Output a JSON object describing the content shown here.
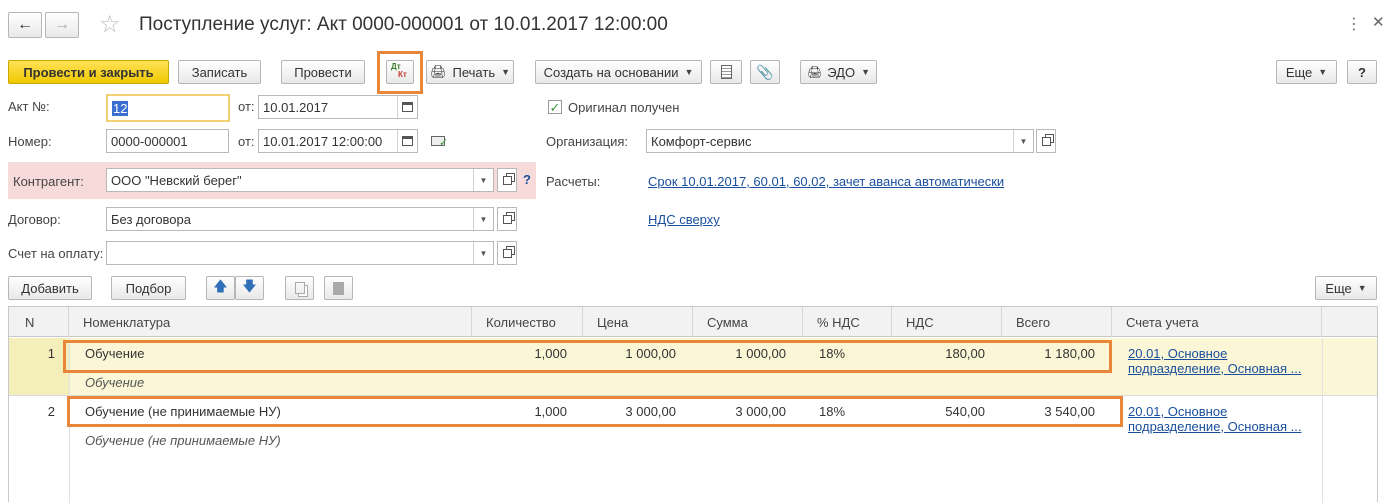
{
  "window": {
    "title": "Поступление услуг: Акт 0000-000001 от 10.01.2017 12:00:00"
  },
  "toolbar": {
    "post_close": "Провести и закрыть",
    "save": "Записать",
    "post": "Провести",
    "dtkt_top": "Дт",
    "dtkt_bottom": "Кт",
    "print": "Печать",
    "create_based": "Создать на основании",
    "edo": "ЭДО",
    "more": "Еще",
    "help": "?"
  },
  "form": {
    "act_no_label": "Акт №:",
    "act_no_value": "12",
    "from_label": "от:",
    "act_date": "10.01.2017",
    "number_label": "Номер:",
    "number_value": "0000-000001",
    "from_label2": "от:",
    "number_date": "10.01.2017 12:00:00",
    "contractor_label": "Контрагент:",
    "contractor_value": "ООО \"Невский берег\"",
    "contract_label": "Договор:",
    "contract_value": "Без договора",
    "invoice_label": "Счет на оплату:",
    "invoice_value": "",
    "original_label": "Оригинал получен",
    "original_checked": true,
    "org_label": "Организация:",
    "org_value": "Комфорт-сервис",
    "settlements_label": "Расчеты:",
    "settlements_link": "Срок 10.01.2017, 60.01, 60.02, зачет аванса автоматически",
    "vat_link": "НДС сверху",
    "help_q": "?"
  },
  "table_toolbar": {
    "add": "Добавить",
    "pick": "Подбор",
    "more": "Еще"
  },
  "table": {
    "columns": [
      "N",
      "Номенклатура",
      "Количество",
      "Цена",
      "Сумма",
      "% НДС",
      "НДС",
      "Всего",
      "Счета учета"
    ],
    "rows": [
      {
        "n": "1",
        "item": "Обучение",
        "item_sub": "Обучение",
        "qty": "1,000",
        "price": "1 000,00",
        "sum": "1 000,00",
        "vat_rate": "18%",
        "vat": "180,00",
        "total": "1 180,00",
        "accounts_line1": "20.01, Основное",
        "accounts_line2": "подразделение, Основная ..."
      },
      {
        "n": "2",
        "item": "Обучение (не принимаемые НУ)",
        "item_sub": "Обучение (не принимаемые НУ)",
        "qty": "1,000",
        "price": "3 000,00",
        "sum": "3 000,00",
        "vat_rate": "18%",
        "vat": "540,00",
        "total": "3 540,00",
        "accounts_line1": "20.01, Основное",
        "accounts_line2": "подразделение, Основная ..."
      }
    ]
  },
  "colors": {
    "accent_orange": "#e8873a",
    "primary_yellow": "#f5d21e",
    "selected_row": "#fbf7d6",
    "contractor_bg": "#f7dada",
    "link_blue": "#1a4f9e"
  }
}
